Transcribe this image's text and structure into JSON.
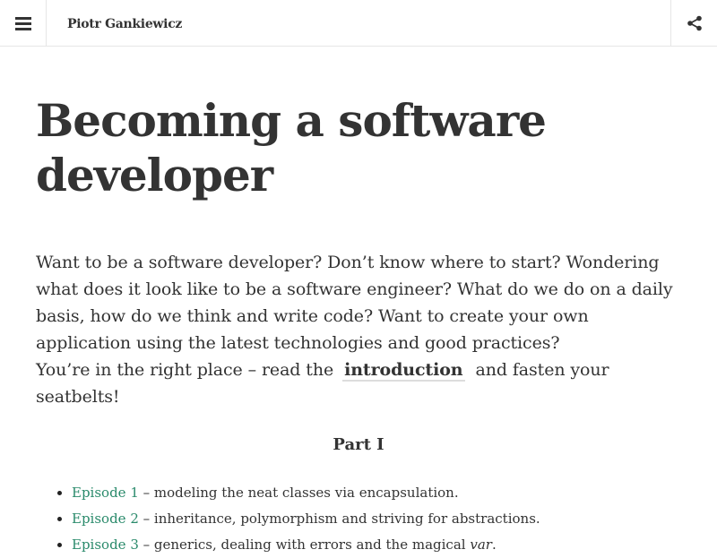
{
  "header": {
    "site_title": "Piotr Gankiewicz",
    "menu_icon": "hamburger-menu-icon",
    "share_icon": "share-icon"
  },
  "article": {
    "title": "Becoming a software developer",
    "intro_text": "Want to be a software developer? Don’t know where to start? Wondering what does it look like to be a software engineer? What do we do on a daily basis, how do we think and write code? Want to create your own application using the latest technologies and good practices?",
    "cta_before": "You’re in the right place – read the",
    "cta_link": "introduction",
    "cta_after": "and fasten your seatbelts!",
    "part_heading": "Part I",
    "episodes": [
      {
        "link": "Episode 1",
        "desc": " – modeling the neat classes via encapsulation.",
        "desc_em": "",
        "desc_end": ""
      },
      {
        "link": "Episode 2",
        "desc": " – inheritance, polymorphism and striving for abstractions.",
        "desc_em": "",
        "desc_end": ""
      },
      {
        "link": "Episode 3",
        "desc": " – generics, dealing with errors and the magical ",
        "desc_em": "var",
        "desc_end": "."
      }
    ]
  },
  "colors": {
    "text": "#333333",
    "link_green": "#2a8a6b",
    "border": "#e6e6e6"
  }
}
